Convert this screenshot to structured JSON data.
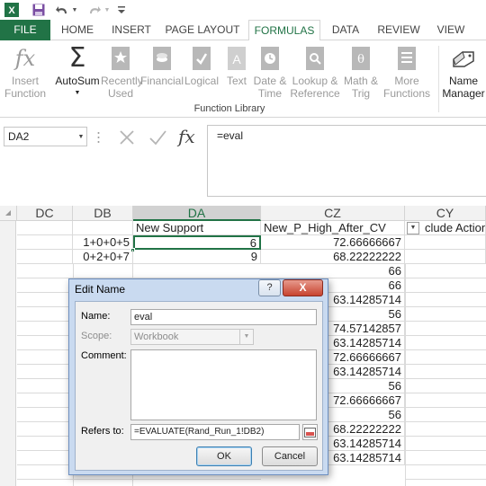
{
  "quick_access": {
    "icons": [
      "excel-logo-icon",
      "save-icon",
      "undo-icon",
      "redo-icon",
      "customize-toolbar-icon"
    ]
  },
  "tabs": [
    "FILE",
    "HOME",
    "INSERT",
    "PAGE LAYOUT",
    "FORMULAS",
    "DATA",
    "REVIEW",
    "VIEW"
  ],
  "active_tab": "FORMULAS",
  "ribbon": {
    "buttons": [
      {
        "line1": "Insert",
        "line2": "Function",
        "icon": "fx-icon"
      },
      {
        "line1": "AutoSum",
        "line2": "",
        "icon": "sigma-icon"
      },
      {
        "line1": "Recently",
        "line2": "Used",
        "icon": "star-book-icon"
      },
      {
        "line1": "Financial",
        "line2": "",
        "icon": "financial-book-icon"
      },
      {
        "line1": "Logical",
        "line2": "",
        "icon": "logical-book-icon"
      },
      {
        "line1": "Text",
        "line2": "",
        "icon": "text-book-icon"
      },
      {
        "line1": "Date &",
        "line2": "Time",
        "icon": "date-time-book-icon"
      },
      {
        "line1": "Lookup &",
        "line2": "Reference",
        "icon": "lookup-book-icon"
      },
      {
        "line1": "Math &",
        "line2": "Trig",
        "icon": "math-book-icon"
      },
      {
        "line1": "More",
        "line2": "Functions",
        "icon": "more-functions-book-icon"
      },
      {
        "line1": "Name",
        "line2": "Manager",
        "icon": "name-manager-icon"
      }
    ],
    "group_label": "Function Library"
  },
  "formula_bar": {
    "name_box": "DA2",
    "formula": "=eval"
  },
  "grid": {
    "columns": [
      "DC",
      "DB",
      "DA",
      "CZ",
      "CY"
    ],
    "selected_column": "DA",
    "header_row": {
      "DA": "New Support",
      "CZ": "New_P_High_After_CV",
      "CY": "clude Action"
    },
    "db_values": [
      "1+0+0+5",
      "0+2+0+7"
    ],
    "da_values": [
      "6",
      "9"
    ],
    "cz_values": [
      "72.66666667",
      "68.22222222",
      "66",
      "66",
      "63.14285714",
      "56",
      "74.57142857",
      "63.14285714",
      "72.66666667",
      "63.14285714",
      "56",
      "72.66666667",
      "56",
      "68.22222222",
      "63.14285714",
      "63.14285714"
    ]
  },
  "dialog": {
    "title": "Edit Name",
    "help": "?",
    "close": "X",
    "name_label": "Name:",
    "name_value": "eval",
    "scope_label": "Scope:",
    "scope_value": "Workbook",
    "comment_label": "Comment:",
    "refers_label": "Refers to:",
    "refers_value": "=EVALUATE(Rand_Run_1!DB2)",
    "ok": "OK",
    "cancel": "Cancel"
  }
}
